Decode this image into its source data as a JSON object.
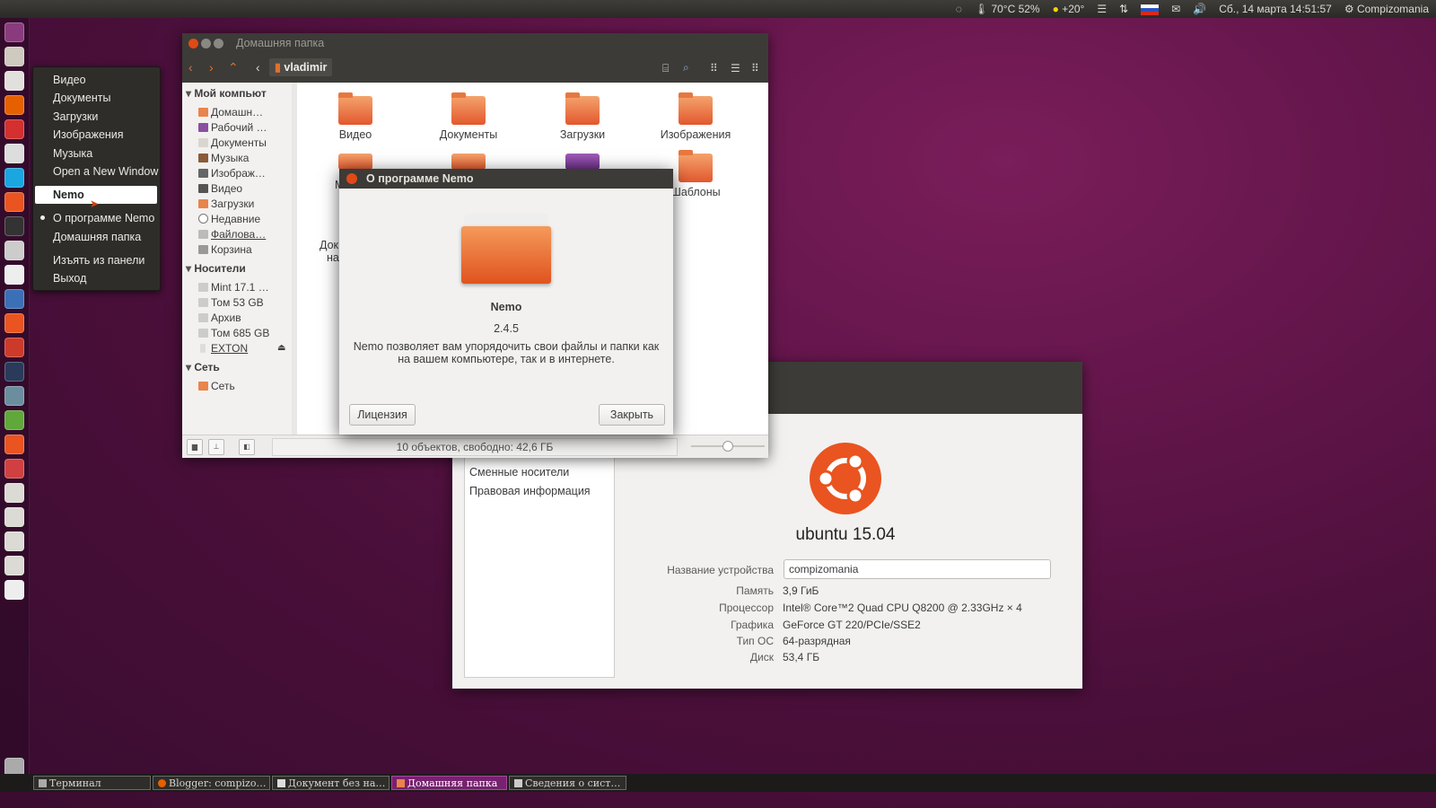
{
  "panel": {
    "temp": "70°C 52%",
    "weather": "+20°",
    "datetime": "Сб., 14 марта 14:51:57",
    "user": "Compizomania"
  },
  "launcher_icons": [
    "dash-icon",
    "files-icon",
    "document-icon",
    "firefox-icon",
    "vivaldi-icon",
    "mail-icon",
    "skype-icon",
    "software-center-icon",
    "terminal-icon",
    "screenshot-icon",
    "text-editor-icon",
    "chromium-icon",
    "settings-icon",
    "update-icon",
    "shotwell-icon",
    "gimp-icon",
    "photo-icon",
    "power-icon",
    "unity-tweak-icon",
    "drive-icon",
    "drive-icon",
    "drive-icon",
    "drive-icon",
    "usb-drive-icon",
    "trash-icon"
  ],
  "context_menu": {
    "items": [
      "Видео",
      "Документы",
      "Загрузки",
      "Изображения",
      "Музыка",
      "Open a New Window"
    ],
    "title": "Nemo",
    "actions": [
      "О программе Nemo",
      "Домашняя папка",
      "Изъять из панели",
      "Выход"
    ]
  },
  "nemo": {
    "title": "Домашняя папка",
    "path": "vladimir",
    "sidebar": {
      "sections": [
        {
          "title": "Мой компьют",
          "items": [
            "Домашн…",
            "Рабочий …",
            "Документы",
            "Музыка",
            "Изображ…",
            "Видео",
            "Загрузки",
            "Недавние",
            "Файлова…",
            "Корзина"
          ]
        },
        {
          "title": "Носители",
          "items": [
            "Mint 17.1 …",
            "Том 53 GB",
            "Архив",
            "Том 685 GB",
            "EXTON"
          ]
        },
        {
          "title": "Сеть",
          "items": [
            "Сеть"
          ]
        }
      ]
    },
    "folders": [
      "Видео",
      "Документы",
      "Загрузки",
      "Изображения",
      "М",
      "",
      "",
      "Шаблоны",
      "Док",
      "на"
    ],
    "status": "10 объектов, свободно: 42,6 ГБ"
  },
  "about": {
    "title": "О программе Nemo",
    "app_name": "Nemo",
    "version": "2.4.5",
    "description1": "Nemo позволяет вам упорядочить свои файлы и папки как",
    "description2": "на вашем компьютере, так и в интернете.",
    "license_button": "Лицензия",
    "close_button": "Закрыть"
  },
  "sysinfo": {
    "side_items": [
      "Сменные носители",
      "Правовая информация"
    ],
    "os_name": "ubuntu 15.04",
    "device_label": "Название устройства",
    "device_value": "compizomania",
    "rows": [
      {
        "label": "Память",
        "value": "3,9 ГиБ"
      },
      {
        "label": "Процессор",
        "value": "Intel® Core™2 Quad CPU Q8200 @ 2.33GHz × 4"
      },
      {
        "label": "Графика",
        "value": "GeForce GT 220/PCIe/SSE2"
      },
      {
        "label": "Тип ОС",
        "value": "64-разрядная"
      },
      {
        "label": "Диск",
        "value": "53,4 ГБ"
      }
    ]
  },
  "taskbar": [
    "Терминал",
    "Blogger: compizo…",
    "Документ без на…",
    "Домашняя папка",
    "Сведения о сист…"
  ],
  "colors": {
    "accent": "#dd4814",
    "ubuntu_orange": "#e95420",
    "taskbar_active": "#77216f"
  }
}
